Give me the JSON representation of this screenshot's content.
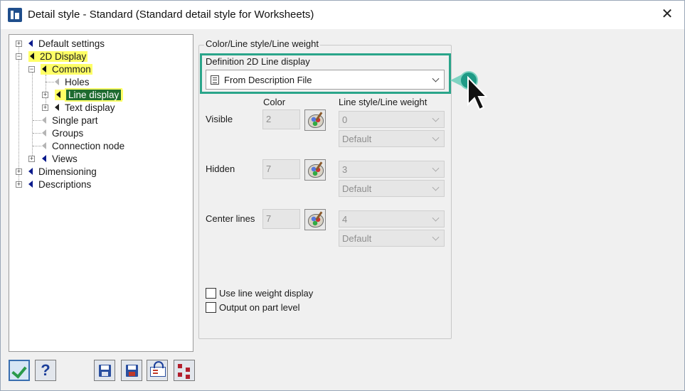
{
  "window": {
    "title": "Detail style - Standard (Standard detail style for Worksheets)",
    "close_glyph": "✕"
  },
  "tree": {
    "items": [
      {
        "label": "Default settings"
      },
      {
        "label": "2D Display"
      },
      {
        "label": "Common"
      },
      {
        "label": "Holes"
      },
      {
        "label": "Line display"
      },
      {
        "label": "Text display"
      },
      {
        "label": "Single part"
      },
      {
        "label": "Groups"
      },
      {
        "label": "Connection node"
      },
      {
        "label": "Views"
      },
      {
        "label": "Dimensioning"
      },
      {
        "label": "Descriptions"
      }
    ]
  },
  "panel": {
    "group_title": "Color/Line style/Line weight",
    "definition_label": "Definition 2D Line display",
    "definition_value": "From Description File",
    "color_header": "Color",
    "linestyle_header": "Line style/Line weight",
    "rows": [
      {
        "label": "Visible",
        "color": "2",
        "style": "0",
        "weight": "Default"
      },
      {
        "label": "Hidden",
        "color": "7",
        "style": "3",
        "weight": "Default"
      },
      {
        "label": "Center lines",
        "color": "7",
        "style": "4",
        "weight": "Default"
      }
    ],
    "checkboxes": [
      {
        "label": "Use line weight display",
        "checked": false
      },
      {
        "label": "Output on part level",
        "checked": false
      }
    ]
  },
  "buttons": {
    "help_glyph": "?"
  },
  "colors": {
    "highlight": "#2aa58a",
    "tree_highlight": "#ffff66",
    "selection": "#1e6b2f"
  }
}
